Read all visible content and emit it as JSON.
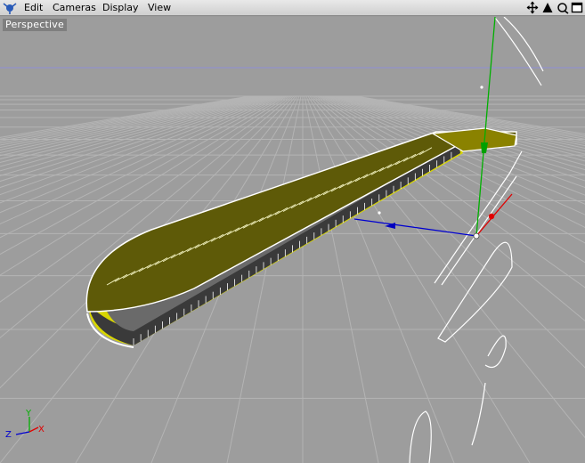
{
  "menubar": {
    "items": [
      {
        "label": "Edit"
      },
      {
        "label": "Cameras"
      },
      {
        "label": "Display"
      },
      {
        "label": "View"
      }
    ],
    "nav_icons": [
      "move-view-icon",
      "zoom-view-icon",
      "rotate-view-icon",
      "maximize-view-icon"
    ]
  },
  "viewport": {
    "label": "Perspective",
    "axis_labels": {
      "x": "X",
      "y": "Y",
      "z": "Z"
    }
  },
  "colors": {
    "menubar_bg": "#dcdcdc",
    "viewport_bg": "#9d9d9d",
    "grid_line": "#b4b4b4",
    "model_top": "#5f5a00",
    "model_side": "#3c3c3c",
    "axis_x": "#e00000",
    "axis_y": "#00b000",
    "axis_z": "#0000d0",
    "selection": "#ffffff"
  }
}
